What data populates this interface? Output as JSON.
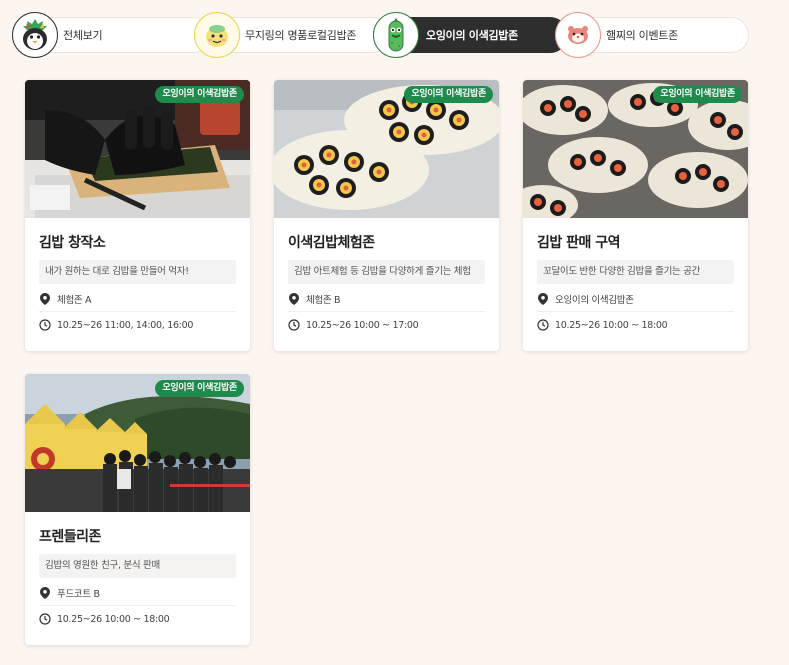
{
  "tabs": [
    {
      "label": "전체보기",
      "icon": "penguin-mascot-icon"
    },
    {
      "label": "무지링의 명품로컬김밥존",
      "icon": "mujiring-mascot-icon"
    },
    {
      "label": "오잉이의 이색김밥존",
      "icon": "oing-cucumber-mascot-icon",
      "active": true
    },
    {
      "label": "햄찌의 이벤트존",
      "icon": "hamzzi-hamster-mascot-icon"
    }
  ],
  "cards": [
    {
      "badge": "오잉이의 이색김밥존",
      "title": "김밥 창작소",
      "desc": "내가 원하는 대로 김밥을 만들어 먹자!",
      "location": "체험존 A",
      "time": "10.25~26 11:00, 14:00, 16:00",
      "image": "gloved-hands-rolling-kimbap-photo"
    },
    {
      "badge": "오잉이의 이색김밥존",
      "title": "이색김밥체험존",
      "desc": "김밥 아트체험 등 김밥을 다양하게 즐기는 체험",
      "location": "체험존 B",
      "time": "10.25~26 10:00 ~ 17:00",
      "image": "kimbap-slices-on-plates-photo"
    },
    {
      "badge": "오잉이의 이색김밥존",
      "title": "김밥 판매 구역",
      "desc": "꼬달이도 반한 다양한 김밥을 즐기는 공간",
      "location": "오잉이의 이색김밥존",
      "time": "10.25~26 10:00 ~ 18:00",
      "image": "kimbap-plates-display-photo"
    },
    {
      "badge": "오잉이의 이색김밥존",
      "title": "프렌들리존",
      "desc": "김밥의 영원한 친구, 분식 판매",
      "location": "푸드코트 B",
      "time": "10.25~26 10:00 ~ 18:00",
      "image": "festival-crowd-yellow-tents-photo"
    }
  ],
  "colors": {
    "background": "#fdf6f0",
    "badge": "#1f8a4c",
    "active_tab": "#2e2e2e",
    "icon": "#333333"
  }
}
